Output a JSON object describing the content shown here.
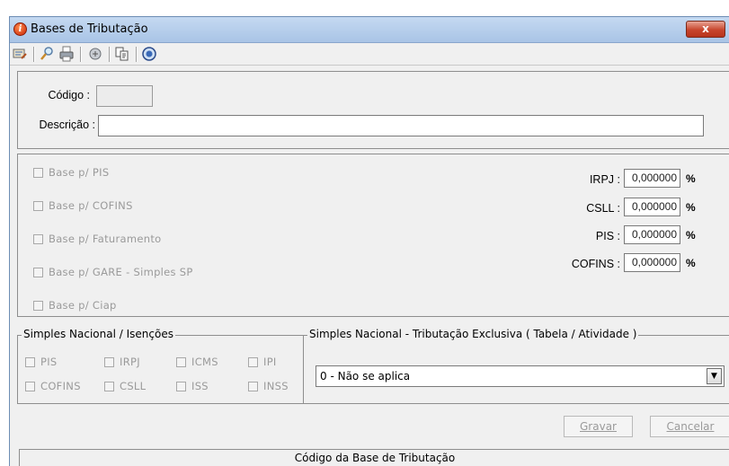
{
  "window": {
    "title": "Bases de Tributação",
    "close_label": "x"
  },
  "toolbar": {
    "icons": [
      "edit-icon",
      "search-icon",
      "print-icon",
      "filter-icon",
      "copy-icon",
      "info-icon"
    ]
  },
  "header": {
    "codigo_label": "Código :",
    "codigo_value": "",
    "descricao_label": "Descrição :",
    "descricao_value": ""
  },
  "bases": [
    {
      "label": "Base p/ PIS",
      "checked": false
    },
    {
      "label": "Base p/ COFINS",
      "checked": false
    },
    {
      "label": "Base p/ Faturamento",
      "checked": false
    },
    {
      "label": "Base p/ GARE - Simples SP",
      "checked": false
    },
    {
      "label": "Base p/ Ciap",
      "checked": false
    }
  ],
  "rates": [
    {
      "label": "IRPJ :",
      "value": "0,000000",
      "unit": "%"
    },
    {
      "label": "CSLL :",
      "value": "0,000000",
      "unit": "%"
    },
    {
      "label": "PIS :",
      "value": "0,000000",
      "unit": "%"
    },
    {
      "label": "COFINS :",
      "value": "0,000000",
      "unit": "%"
    }
  ],
  "simples_isencoes": {
    "title": "Simples Nacional / Isenções",
    "items": [
      "PIS",
      "IRPJ",
      "ICMS",
      "IPI",
      "COFINS",
      "CSLL",
      "ISS",
      "INSS"
    ]
  },
  "simples_exclusiva": {
    "title": "Simples Nacional  - Tributação Exclusiva ( Tabela / Atividade )",
    "selected": "0 - Não se aplica"
  },
  "actions": {
    "save_label": "Gravar",
    "cancel_label": "Cancelar"
  },
  "grid": {
    "column": "Código da Base de Tributação"
  }
}
